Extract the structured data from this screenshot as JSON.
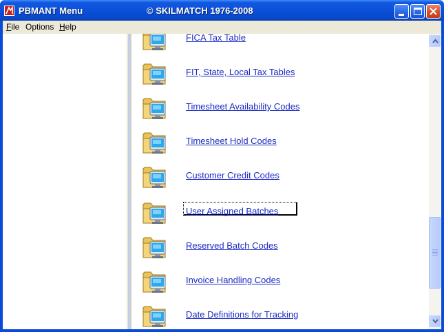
{
  "window": {
    "title": "PBMANT Menu",
    "copyright": "© SKILMATCH 1976-2008"
  },
  "menubar": {
    "file": {
      "accel": "F",
      "rest": "ile"
    },
    "options": {
      "accel": "",
      "rest": "Options"
    },
    "help": {
      "accel": "H",
      "rest": "elp"
    }
  },
  "menu_items": [
    {
      "label": "FICA Tax Table",
      "icon": "folder-computer-icon"
    },
    {
      "label": "FIT, State, Local Tax Tables",
      "icon": "folder-computer-icon"
    },
    {
      "label": "Timesheet Availability Codes",
      "icon": "folder-computer-icon"
    },
    {
      "label": "Timesheet Hold Codes",
      "icon": "folder-computer-icon"
    },
    {
      "label": "Customer Credit Codes",
      "icon": "folder-computer-icon"
    },
    {
      "label": "User Assigned Batches",
      "icon": "folder-computer-icon",
      "focused": true
    },
    {
      "label": "Reserved Batch Codes",
      "icon": "folder-computer-icon"
    },
    {
      "label": "Invoice Handling Codes",
      "icon": "folder-computer-icon"
    },
    {
      "label": "Date Definitions for Tracking",
      "icon": "folder-computer-icon"
    }
  ],
  "colors": {
    "titlebar": "#0a4fd8",
    "link": "#1b2bc4",
    "menubar_bg": "#ece9d8"
  }
}
